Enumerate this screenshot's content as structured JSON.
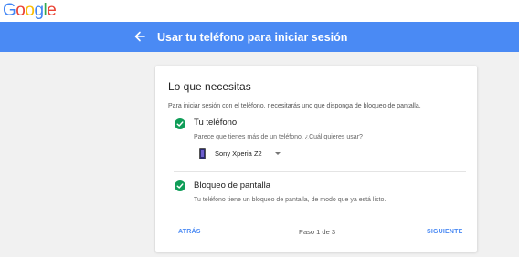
{
  "header": {
    "logo_letters": [
      {
        "char": "G",
        "color": "#4285f4"
      },
      {
        "char": "o",
        "color": "#ea4335"
      },
      {
        "char": "o",
        "color": "#fbbc05"
      },
      {
        "char": "g",
        "color": "#4285f4"
      },
      {
        "char": "l",
        "color": "#34a853"
      },
      {
        "char": "e",
        "color": "#ea4335"
      }
    ]
  },
  "appbar": {
    "back_icon": "arrow-left-icon",
    "title": "Usar tu teléfono para iniciar sesión",
    "color": "#4a8af4"
  },
  "card": {
    "title": "Lo que necesitas",
    "description": "Para iniciar sesión con el teléfono, necesitarás uno que disponga de bloqueo de pantalla.",
    "items": [
      {
        "icon": "check-circle-icon",
        "title": "Tu teléfono",
        "subtitle": "Parece que tienes más de un teléfono. ¿Cuál quieres usar?",
        "device": {
          "icon": "phone-icon",
          "selected": "Sony Xperia Z2",
          "dropdown_icon": "caret-down-icon"
        }
      },
      {
        "icon": "check-circle-icon",
        "title": "Bloqueo de pantalla",
        "subtitle": "Tu teléfono tiene un bloqueo de pantalla, de modo que ya está listo."
      }
    ],
    "footer": {
      "back_label": "ATRÁS",
      "step_label": "Paso 1 de 3",
      "next_label": "SIGUIENTE"
    },
    "check_color": "#0f9d58"
  }
}
